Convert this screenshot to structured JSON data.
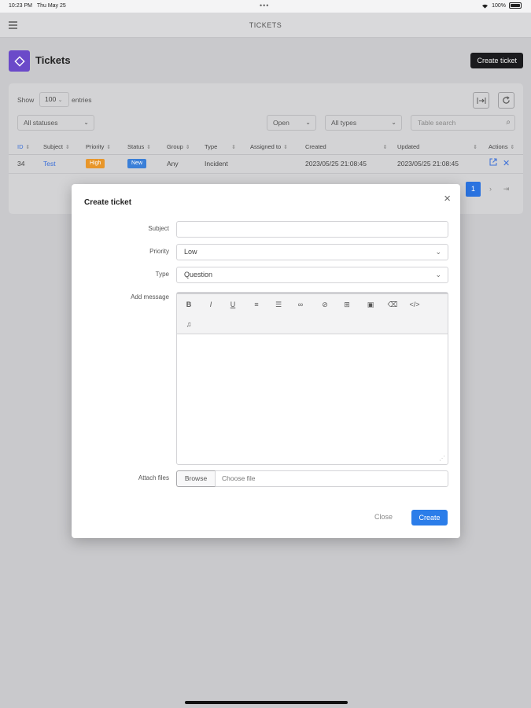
{
  "status_bar": {
    "time": "10:23 PM",
    "date": "Thu May 25",
    "dots": "•••",
    "battery": "100%"
  },
  "nav": {
    "title": "TICKETS"
  },
  "header": {
    "title": "Tickets",
    "create_button": "Create ticket"
  },
  "table_controls": {
    "show_label": "Show",
    "show_value": "100",
    "entries_label": "entries",
    "status_filter": "All statuses",
    "state_filter": "Open",
    "type_filter": "All types",
    "search_placeholder": "Table search"
  },
  "table": {
    "columns": [
      "ID",
      "Subject",
      "Priority",
      "Status",
      "Group",
      "Type",
      "Assigned to",
      "Created",
      "Updated",
      "Actions"
    ],
    "rows": [
      {
        "id": "34",
        "subject": "Test",
        "priority": "High",
        "status": "New",
        "group": "Any",
        "type": "Incident",
        "assigned_to": "",
        "created": "2023/05/25 21:08:45",
        "updated": "2023/05/25 21:08:45"
      }
    ],
    "current_page": "1"
  },
  "modal": {
    "title": "Create ticket",
    "close_icon": "×",
    "subject_label": "Subject",
    "subject_value": "",
    "priority_label": "Priority",
    "priority_value": "Low",
    "type_label": "Type",
    "type_value": "Question",
    "message_label": "Add message",
    "attach_label": "Attach files",
    "browse_button": "Browse",
    "choose_file": "Choose file",
    "close_button": "Close",
    "create_button": "Create"
  },
  "colors": {
    "accent": "#2b7de9",
    "brand": "#6b4ac9",
    "high": "#e8962a",
    "new": "#3a7fd8"
  },
  "editor_icons": [
    "bold-icon",
    "italic-icon",
    "underline-icon",
    "ordered-list-icon",
    "unordered-list-icon",
    "link-icon",
    "unlink-icon",
    "table-icon",
    "image-icon",
    "eraser-icon",
    "code-icon",
    "bell-icon"
  ]
}
